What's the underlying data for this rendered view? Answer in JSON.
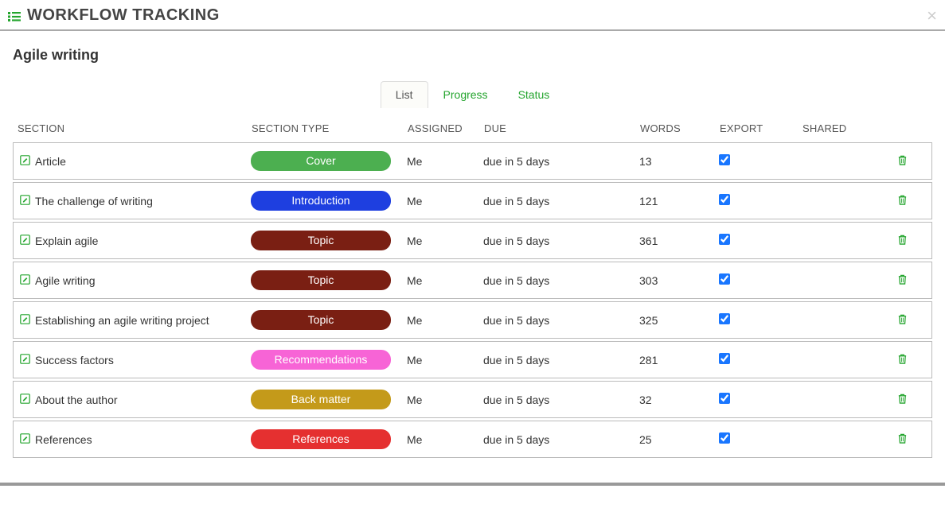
{
  "header": {
    "title": "WORKFLOW TRACKING"
  },
  "doc_title": "Agile writing",
  "tabs": {
    "list": "List",
    "progress": "Progress",
    "status": "Status",
    "active": "list"
  },
  "columns": {
    "section": "SECTION",
    "type": "SECTION TYPE",
    "assigned": "ASSIGNED",
    "due": "DUE",
    "words": "WORDS",
    "export": "EXPORT",
    "shared": "SHARED"
  },
  "rows": [
    {
      "section": "Article",
      "type": "Cover",
      "type_class": "badge-cover",
      "assigned": "Me",
      "due": "due in 5 days",
      "words": "13",
      "export": true
    },
    {
      "section": "The challenge of writing",
      "type": "Introduction",
      "type_class": "badge-intro",
      "assigned": "Me",
      "due": "due in 5 days",
      "words": "121",
      "export": true
    },
    {
      "section": "Explain agile",
      "type": "Topic",
      "type_class": "badge-topic",
      "assigned": "Me",
      "due": "due in 5 days",
      "words": "361",
      "export": true
    },
    {
      "section": "Agile writing",
      "type": "Topic",
      "type_class": "badge-topic",
      "assigned": "Me",
      "due": "due in 5 days",
      "words": "303",
      "export": true
    },
    {
      "section": "Establishing an agile writing project",
      "type": "Topic",
      "type_class": "badge-topic",
      "assigned": "Me",
      "due": "due in 5 days",
      "words": "325",
      "export": true
    },
    {
      "section": "Success factors",
      "type": "Recommendations",
      "type_class": "badge-reco",
      "assigned": "Me",
      "due": "due in 5 days",
      "words": "281",
      "export": true
    },
    {
      "section": "About the author",
      "type": "Back matter",
      "type_class": "badge-back",
      "assigned": "Me",
      "due": "due in 5 days",
      "words": "32",
      "export": true
    },
    {
      "section": "References",
      "type": "References",
      "type_class": "badge-ref",
      "assigned": "Me",
      "due": "due in 5 days",
      "words": "25",
      "export": true
    }
  ]
}
